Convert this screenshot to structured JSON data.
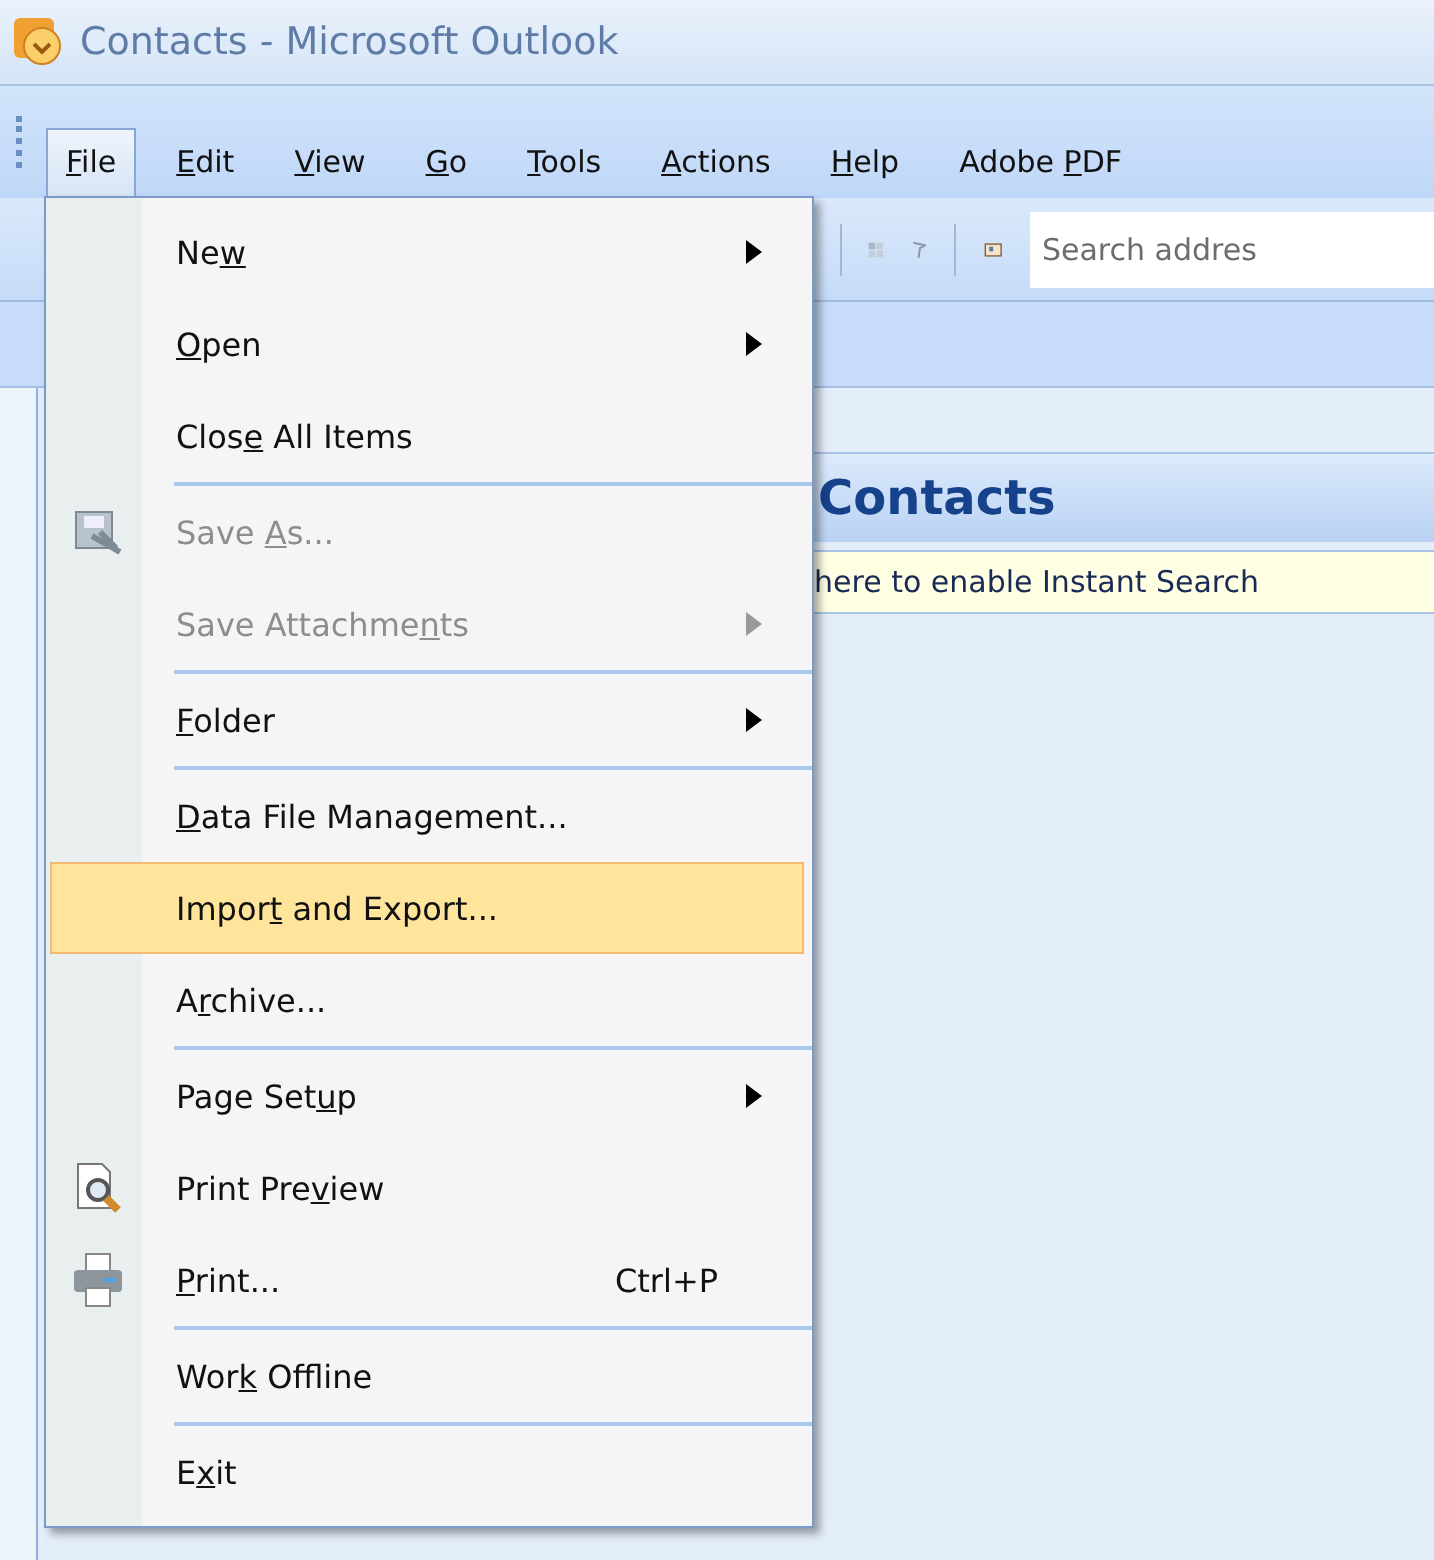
{
  "window": {
    "title": "Contacts - Microsoft Outlook"
  },
  "menubar": [
    {
      "key": "F",
      "post": "ile",
      "selected": true
    },
    {
      "key": "E",
      "post": "dit",
      "selected": false
    },
    {
      "key": "V",
      "post": "iew",
      "selected": false
    },
    {
      "key": "G",
      "post": "o",
      "selected": false
    },
    {
      "key": "T",
      "post": "ools",
      "selected": false
    },
    {
      "key": "A",
      "post": "ctions",
      "selected": false
    },
    {
      "key": "H",
      "post": "elp",
      "selected": false
    },
    {
      "pre": "Adobe ",
      "key": "P",
      "post": "DF",
      "selected": false
    }
  ],
  "toolbar": {
    "search": {
      "placeholder": "Search addres"
    }
  },
  "header": {
    "title": "Contacts"
  },
  "infobar": {
    "text": "here to enable Instant Search"
  },
  "file_menu": {
    "items": [
      {
        "kind": "item",
        "pre": "Ne",
        "key": "w",
        "submenu": true,
        "disabled": false,
        "selected": false
      },
      {
        "kind": "item",
        "key": "O",
        "post": "pen",
        "submenu": true,
        "disabled": false,
        "selected": false
      },
      {
        "kind": "item",
        "pre": "Clos",
        "key": "e",
        "post": " All Items",
        "submenu": false,
        "disabled": false,
        "selected": false
      },
      {
        "kind": "separator"
      },
      {
        "kind": "save",
        "pre": "Save ",
        "key": "A",
        "post": "s...",
        "submenu": false,
        "disabled": true,
        "selected": false
      },
      {
        "kind": "item",
        "pre": "Save Attachme",
        "key": "n",
        "post": "ts",
        "submenu": true,
        "disabled": true,
        "selected": false
      },
      {
        "kind": "separator"
      },
      {
        "kind": "item",
        "key": "F",
        "post": "older",
        "submenu": true,
        "disabled": false,
        "selected": false
      },
      {
        "kind": "separator"
      },
      {
        "kind": "item",
        "key": "D",
        "post": "ata File Management...",
        "submenu": false,
        "disabled": false,
        "selected": false
      },
      {
        "kind": "item",
        "pre": "Impor",
        "key": "t",
        "post": " and Export...",
        "submenu": false,
        "disabled": false,
        "selected": true
      },
      {
        "kind": "item",
        "pre": "A",
        "key": "r",
        "post": "chive...",
        "submenu": false,
        "disabled": false,
        "selected": false
      },
      {
        "kind": "separator"
      },
      {
        "kind": "item",
        "pre": "Page Set",
        "key": "u",
        "post": "p",
        "submenu": true,
        "disabled": false,
        "selected": false
      },
      {
        "kind": "preview",
        "pre": "Print Pre",
        "key": "v",
        "post": "iew",
        "submenu": false,
        "disabled": false,
        "selected": false
      },
      {
        "kind": "print",
        "key": "P",
        "post": "rint...",
        "shortcut": "Ctrl+P",
        "submenu": false,
        "disabled": false,
        "selected": false
      },
      {
        "kind": "separator"
      },
      {
        "kind": "item",
        "pre": "Wor",
        "key": "k",
        "post": " Offline",
        "submenu": false,
        "disabled": false,
        "selected": false
      },
      {
        "kind": "separator"
      },
      {
        "kind": "item",
        "pre": "E",
        "key": "x",
        "post": "it",
        "submenu": false,
        "disabled": false,
        "selected": false
      }
    ]
  }
}
